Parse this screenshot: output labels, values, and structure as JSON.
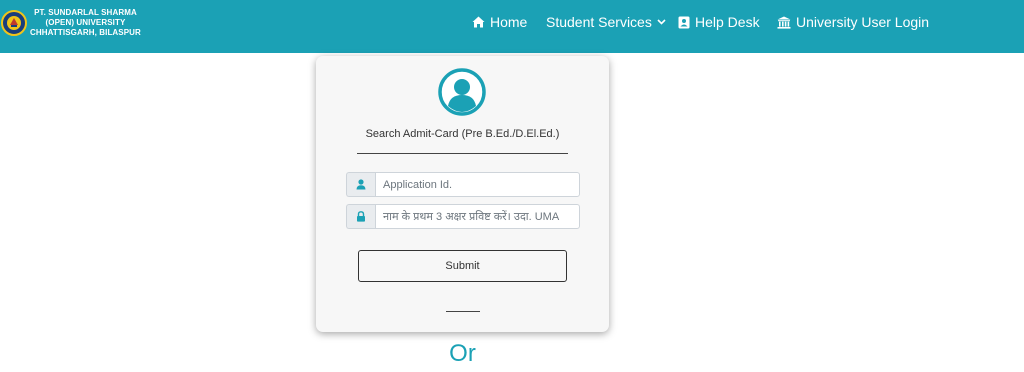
{
  "brand": {
    "line1": "PT. SUNDARLAL SHARMA",
    "line2": "(OPEN) UNIVERSITY",
    "line3": "CHHATTISGARH, BILASPUR",
    "logo_icon": "university-seal-icon"
  },
  "nav": {
    "home": "Home",
    "student_services": "Student Services",
    "help_desk": "Help Desk",
    "university_login": "University User Login",
    "icons": [
      "home-icon",
      "chevron-down-icon",
      "contact-card-icon",
      "institution-icon"
    ]
  },
  "form": {
    "avatar_icon": "user-circle-icon",
    "title": "Search Admit-Card (Pre B.Ed./D.El.Ed.)",
    "application_placeholder": "Application Id.",
    "name_placeholder": "नाम के प्रथम 3 अक्षर प्रविष्ट करें। उदा. UMA",
    "submit_label": "Submit",
    "field_icons": [
      "user-icon",
      "lock-icon"
    ]
  },
  "or_text": "Or",
  "colors": {
    "primary": "#1ba1b5",
    "card_bg": "#f7f7f7",
    "addon_icon": "#1ba1b5"
  }
}
